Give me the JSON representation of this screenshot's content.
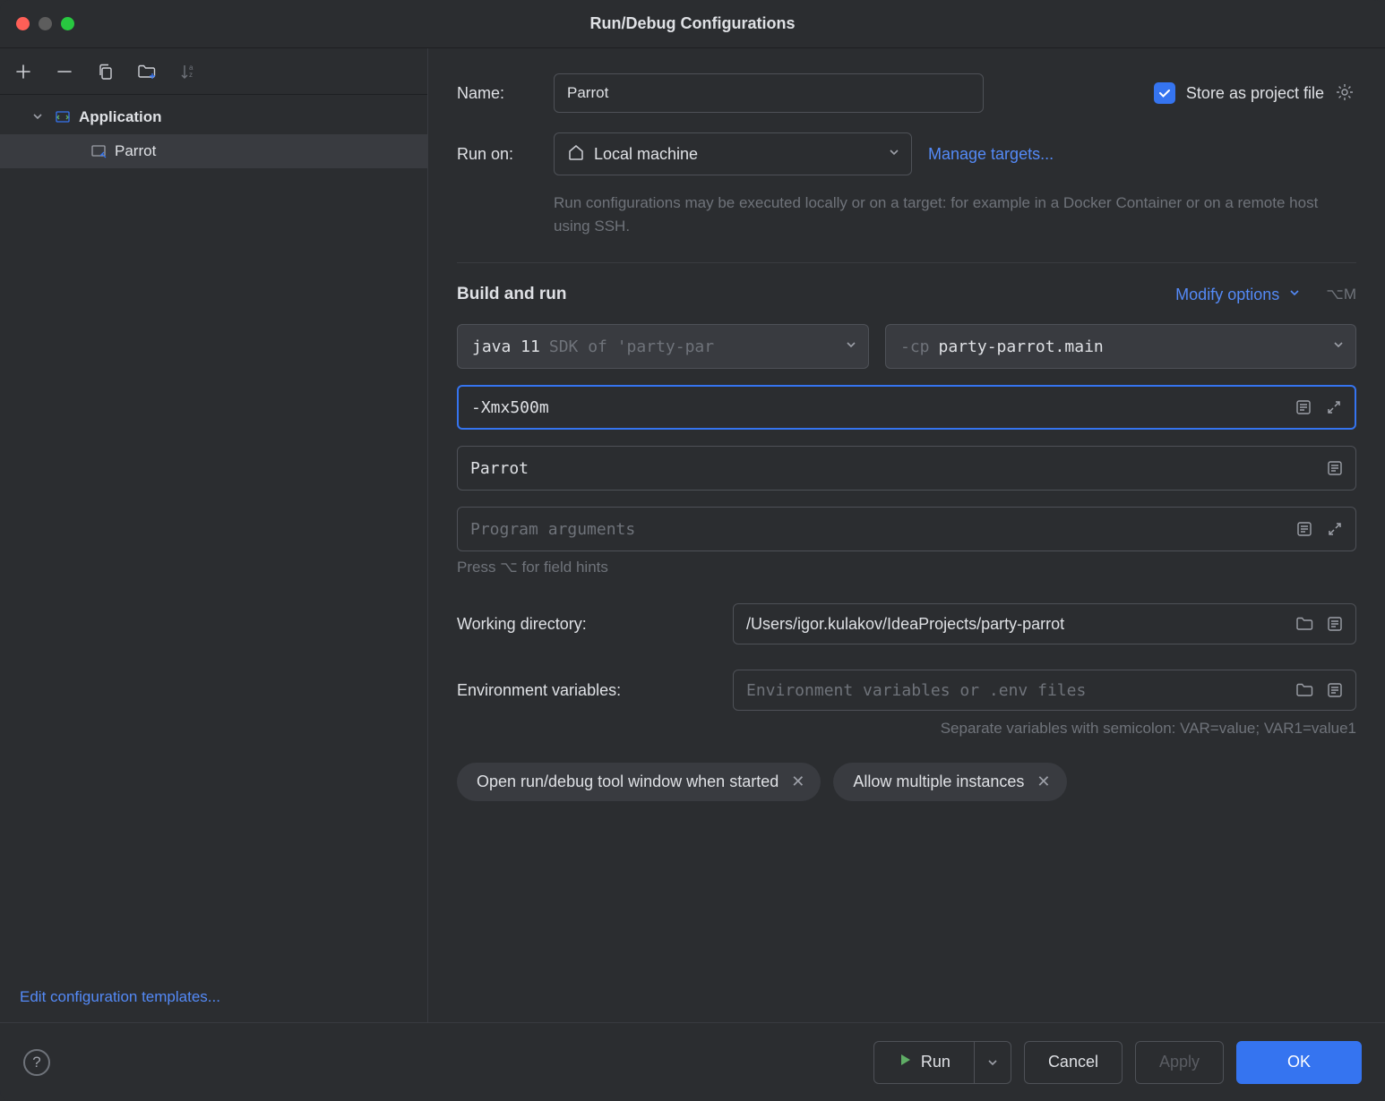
{
  "title": "Run/Debug Configurations",
  "sidebar": {
    "root_label": "Application",
    "item_label": "Parrot",
    "edit_templates": "Edit configuration templates..."
  },
  "form": {
    "name_label": "Name:",
    "name_value": "Parrot",
    "store_label": "Store as project file",
    "runon_label": "Run on:",
    "runon_value": "Local machine",
    "manage_targets": "Manage targets...",
    "runon_desc": "Run configurations may be executed locally or on a target: for example in a Docker Container or on a remote host using SSH.",
    "section_title": "Build and run",
    "modify_options": "Modify options",
    "modify_shortcut": "⌥M",
    "sdk_primary": "java 11",
    "sdk_secondary": "SDK of 'party-par",
    "cp_prefix": "-cp",
    "cp_value": "party-parrot.main",
    "vm_options_value": "-Xmx500m",
    "main_class_value": "Parrot",
    "program_args_placeholder": "Program arguments",
    "hint": "Press ⌥ for field hints",
    "workdir_label": "Working directory:",
    "workdir_value": "/Users/igor.kulakov/IdeaProjects/party-parrot",
    "envvar_label": "Environment variables:",
    "envvar_placeholder": "Environment variables or .env files",
    "envvar_hint": "Separate variables with semicolon: VAR=value; VAR1=value1",
    "chip1": "Open run/debug tool window when started",
    "chip2": "Allow multiple instances"
  },
  "footer": {
    "run": "Run",
    "cancel": "Cancel",
    "apply": "Apply",
    "ok": "OK"
  }
}
